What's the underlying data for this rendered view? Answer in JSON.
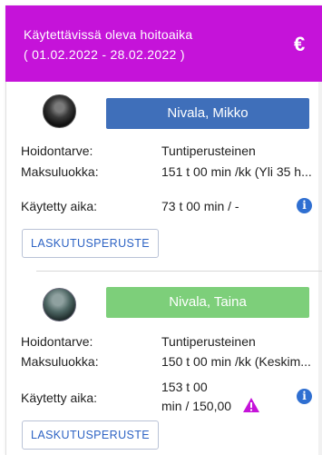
{
  "header": {
    "title": "Käytettävissä oleva hoitoaika",
    "period": "( 01.02.2022 - 28.02.2022 )",
    "currency_icon": "euro-icon",
    "color": "#c513d9"
  },
  "children": [
    {
      "name": "Nivala, Mikko",
      "button_color": "#3f6fba",
      "rows": {
        "care_need_label": "Hoidontarve:",
        "care_need_value": "Tuntiperusteinen",
        "fee_class_label": "Maksuluokka:",
        "fee_class_value": "151 t 00 min /kk (Yli 35 h...",
        "used_time_label": "Käytetty aika:",
        "used_time_value": "73 t 00 min / -"
      },
      "info_icon": "info-icon",
      "billing_button": "LASKUTUSPERUSTE"
    },
    {
      "name": "Nivala, Taina",
      "button_color": "#7dcf7a",
      "rows": {
        "care_need_label": "Hoidontarve:",
        "care_need_value": "Tuntiperusteinen",
        "fee_class_label": "Maksuluokka:",
        "fee_class_value": "150 t 00 min /kk (Keskim...",
        "used_time_label": "Käytetty aika:",
        "used_time_value_line1": "153 t 00",
        "used_time_value_line2": "min / 150,00"
      },
      "warning_icon": "warning-icon",
      "warning_color": "#c513d9",
      "info_icon": "info-icon",
      "billing_button": "LASKUTUSPERUSTE"
    }
  ]
}
